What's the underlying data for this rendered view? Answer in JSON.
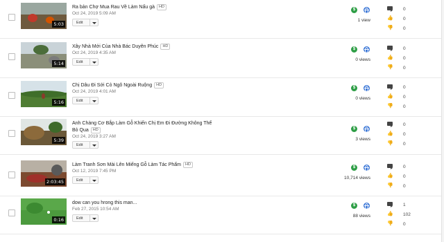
{
  "edit_label": "Edit",
  "hd_label": "HD",
  "icons": {
    "monetization": "dollar-circle-icon",
    "visibility": "globe-icon",
    "comments": "comment-icon",
    "likes": "thumbs-up-icon",
    "dislikes": "thumbs-down-icon",
    "more": "chevron-down-icon"
  },
  "colors": {
    "monetization": "#2e9e46",
    "visibility": "#3a76d6"
  },
  "videos": [
    {
      "title": "Ra bản Chợ Mua Rau Về Làm Nấu gà",
      "hd": true,
      "date": "Oct 24, 2019 5:09 AM",
      "duration": "5:03",
      "views": "1 view",
      "comments": "0",
      "likes": "0",
      "dislikes": "0"
    },
    {
      "title": "Xây Nhà Mới Của Nhà Bác Duyên Phúc",
      "hd": true,
      "date": "Oct 24, 2019 4:35 AM",
      "duration": "5:14",
      "views": "0 views",
      "comments": "0",
      "likes": "0",
      "dislikes": "0"
    },
    {
      "title": "Chị Dâu Đi Sới Cỏ Ngô Ngoài Ruộng",
      "hd": true,
      "date": "Oct 24, 2019 4:01 AM",
      "duration": "5:16",
      "views": "0 views",
      "comments": "0",
      "likes": "0",
      "dislikes": "0"
    },
    {
      "title": "Anh Chàng Cơ Bắp Làm Gỗ Khiến Chị Em Đi Đường Không Thể Bỏ Qua",
      "hd": true,
      "date": "Oct 24, 2019 3:27 AM",
      "duration": "5:39",
      "views": "3 views",
      "comments": "0",
      "likes": "0",
      "dislikes": "0"
    },
    {
      "title": "Làm Tranh Sơn Mài Lên Miếng Gỗ Làm Tác Phẩm",
      "hd": true,
      "date": "Oct 12, 2019 7:45 PM",
      "duration": "2:03:45",
      "views": "10,714 views",
      "comments": "0",
      "likes": "0",
      "dislikes": "0"
    },
    {
      "title": "dow can you hrong this man...",
      "hd": false,
      "date": "Feb 27, 2015 10:54 AM",
      "duration": "0:16",
      "views": "88 views",
      "comments": "1",
      "likes": "102",
      "dislikes": "0"
    }
  ]
}
